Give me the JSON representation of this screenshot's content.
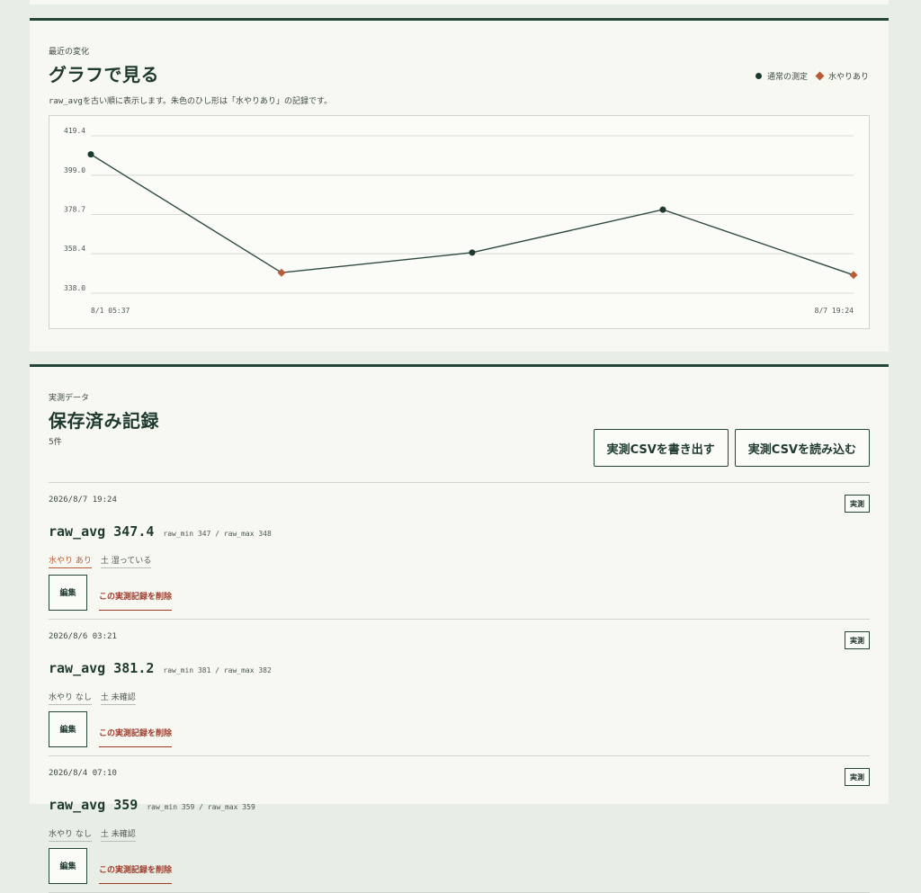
{
  "chart_section": {
    "eyebrow": "最近の変化",
    "title": "グラフで見る",
    "desc_code": "raw_avg",
    "desc_text": "を古い順に表示します。朱色のひし形は「水やりあり」の記録です。",
    "legend_normal": "通常の測定",
    "legend_water": "水やりあり",
    "colors": {
      "line": "#2e4a3f",
      "normal_marker": "#1e3a2f",
      "water_marker": "#b85c38",
      "grid": "#d6dbd3"
    }
  },
  "chart_data": {
    "type": "line",
    "title": "",
    "xlabel": "",
    "ylabel": "",
    "x_tick_labels": [
      "8/1 05:37",
      "8/7 19:24"
    ],
    "y_ticks": [
      419.4,
      399.0,
      378.7,
      358.4,
      338.0
    ],
    "y_tick_labels": [
      "419.4",
      "399.0",
      "378.7",
      "358.4",
      "338.0"
    ],
    "ylim": [
      338.0,
      419.4
    ],
    "grid": true,
    "legend_position": "top-right",
    "series": [
      {
        "name": "raw_avg",
        "points": [
          {
            "label": "8/1 05:37",
            "value": 409.8,
            "watered": false
          },
          {
            "label": "",
            "value": 348.6,
            "watered": true
          },
          {
            "label": "8/4 07:10",
            "value": 359,
            "watered": false
          },
          {
            "label": "8/6 03:21",
            "value": 381.2,
            "watered": false
          },
          {
            "label": "8/7 19:24",
            "value": 347.4,
            "watered": true
          }
        ]
      }
    ]
  },
  "records_section": {
    "eyebrow": "実測データ",
    "title": "保存済み記録",
    "count": "5件",
    "export_label": "実測CSVを書き出す",
    "import_label": "実測CSVを読み込む"
  },
  "records": [
    {
      "date": "2026/8/7 19:24",
      "badge": "実測",
      "avg": "raw_avg 347.4",
      "minmax": "raw_min 347 / raw_max 348",
      "water": "水やり あり",
      "watered": true,
      "soil": "土 湿っている",
      "edit": "編集",
      "delete": "この実測記録を削除"
    },
    {
      "date": "2026/8/6 03:21",
      "badge": "実測",
      "avg": "raw_avg 381.2",
      "minmax": "raw_min 381 / raw_max 382",
      "water": "水やり なし",
      "watered": false,
      "soil": "土 未確認",
      "edit": "編集",
      "delete": "この実測記録を削除"
    },
    {
      "date": "2026/8/4 07:10",
      "badge": "実測",
      "avg": "raw_avg 359",
      "minmax": "raw_min 359 / raw_max 359",
      "water": "水やり なし",
      "watered": false,
      "soil": "土 未確認",
      "edit": "編集",
      "delete": "この実測記録を削除"
    }
  ]
}
